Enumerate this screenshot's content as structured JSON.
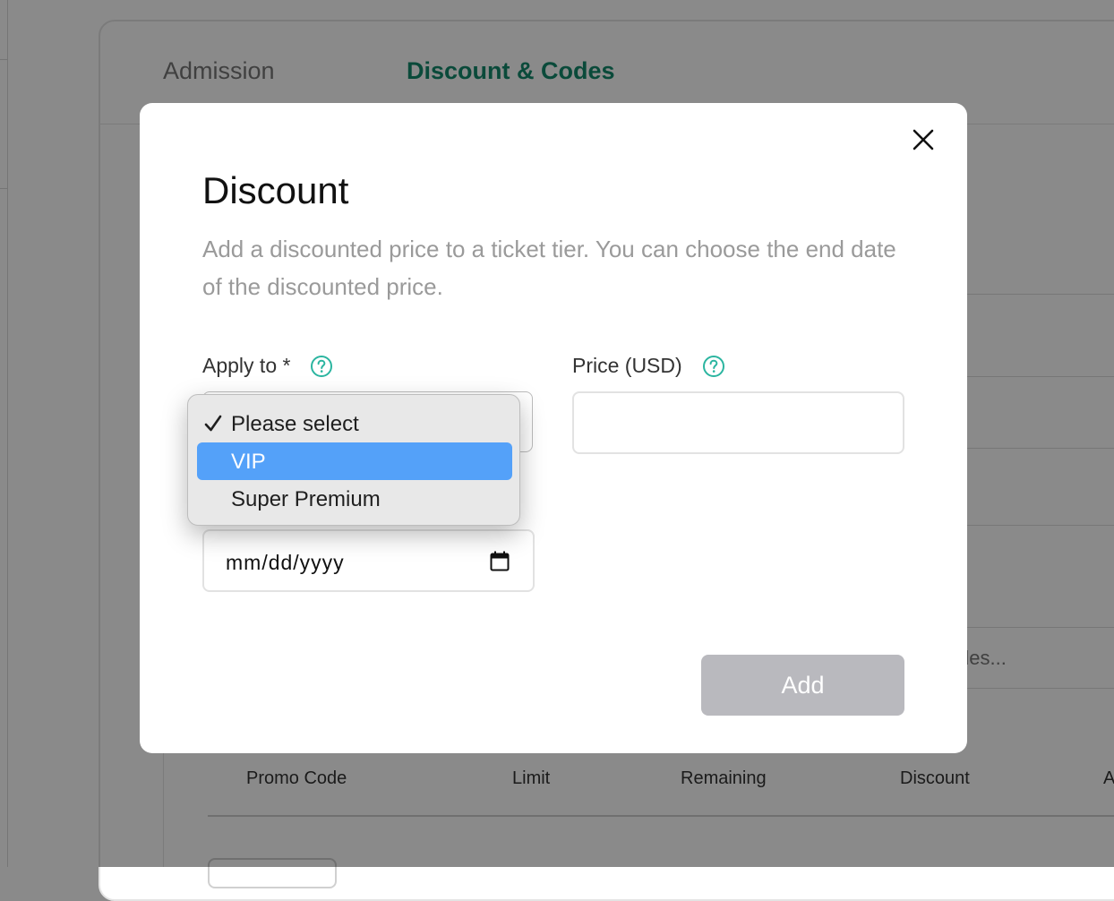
{
  "background": {
    "tabs": [
      {
        "label": "Admission",
        "active": false
      },
      {
        "label": "Discount & Codes",
        "active": true
      }
    ],
    "accent_color": "#138a6c",
    "partial_text": "des...",
    "table_headers": [
      "Promo Code",
      "Limit",
      "Remaining",
      "Discount",
      "A"
    ]
  },
  "modal": {
    "title": "Discount",
    "description": "Add a discounted price to a ticket tier. You can choose the end date of the discounted price.",
    "close_icon": "close-icon",
    "apply_to": {
      "label": "Apply to *",
      "help_icon": "question-circle-icon",
      "options": [
        {
          "label": "Please select",
          "checked": true,
          "highlighted": false
        },
        {
          "label": "VIP",
          "checked": false,
          "highlighted": true
        },
        {
          "label": "Super Premium",
          "checked": false,
          "highlighted": false
        }
      ]
    },
    "price": {
      "label": "Price (USD)",
      "help_icon": "question-circle-icon",
      "value": ""
    },
    "end_date": {
      "placeholder": "mm/dd/yyyy",
      "icon": "calendar-icon"
    },
    "add_button": "Add",
    "colors": {
      "help_icon": "#2bb5a0",
      "highlight": "#54a1f9",
      "button_disabled": "#b9b9be"
    }
  }
}
